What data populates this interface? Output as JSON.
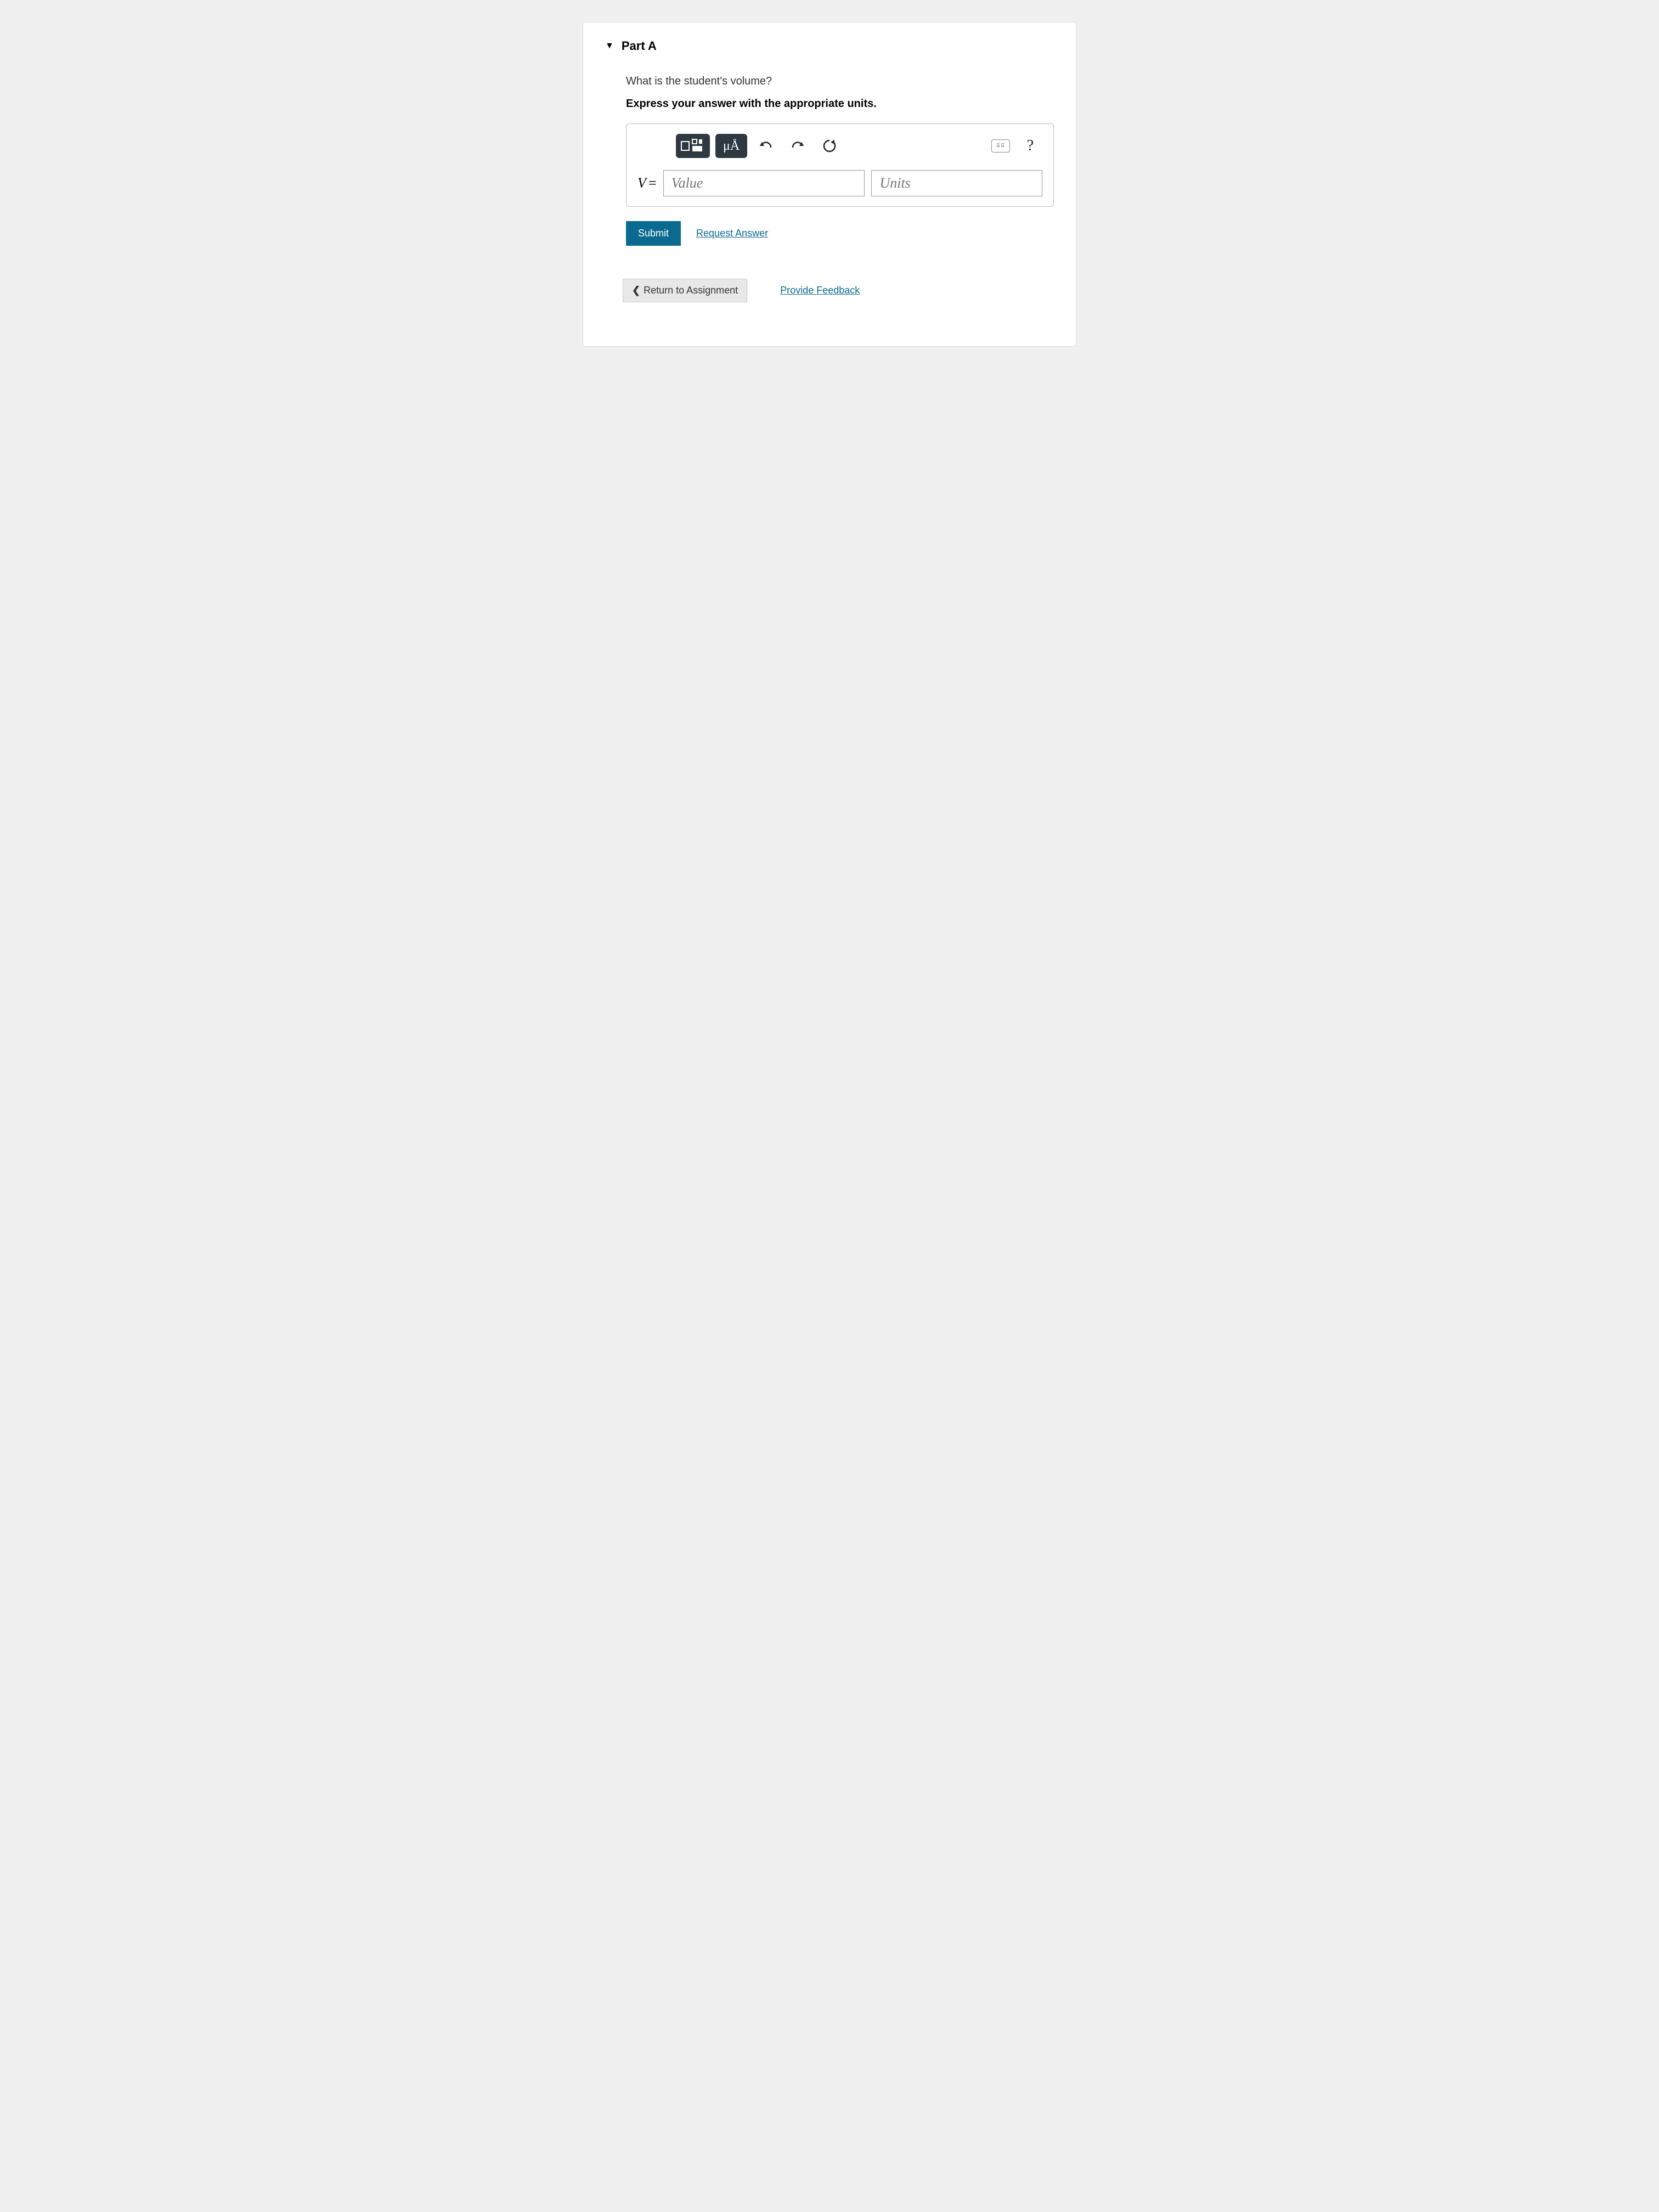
{
  "part": {
    "title": "Part A",
    "question": "What is the student's volume?",
    "instruction": "Express your answer with the appropriate units."
  },
  "toolbar": {
    "templates_label": "templates",
    "symbols_label": "μÅ",
    "undo_label": "undo",
    "redo_label": "redo",
    "reset_label": "reset",
    "keyboard_label": "keyboard",
    "help_label": "?"
  },
  "answer": {
    "variable": "V",
    "equals": "=",
    "value_placeholder": "Value",
    "units_placeholder": "Units"
  },
  "actions": {
    "submit": "Submit",
    "request_answer": "Request Answer",
    "return": "Return to Assignment",
    "feedback": "Provide Feedback"
  }
}
